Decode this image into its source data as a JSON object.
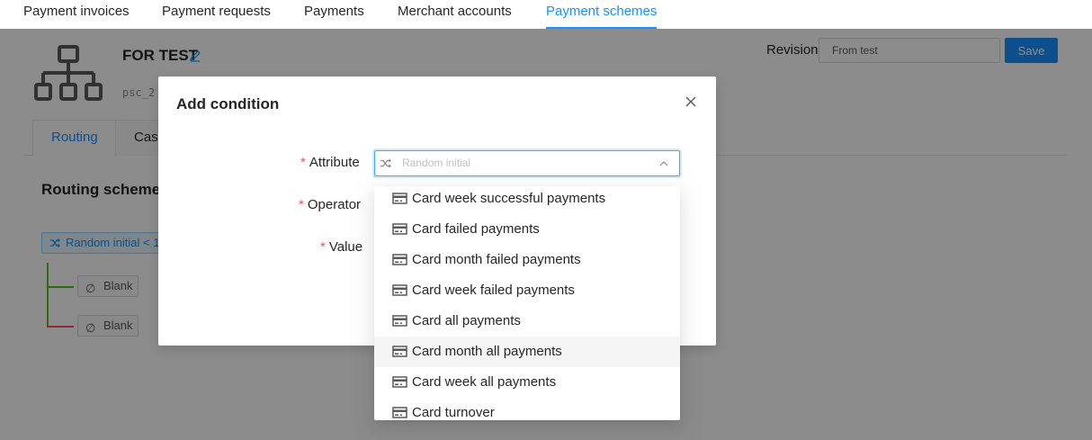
{
  "topnav": {
    "tabs": [
      {
        "label": "Payment invoices"
      },
      {
        "label": "Payment requests"
      },
      {
        "label": "Payments"
      },
      {
        "label": "Merchant accounts"
      },
      {
        "label": "Payment schemes"
      }
    ],
    "active_index": 4
  },
  "scheme": {
    "title": "FOR TEST",
    "code": "psc_2",
    "revision_label": "Revision",
    "revision_value": "From test",
    "save_label": "Save"
  },
  "inner_tabs": [
    {
      "label": "Routing"
    },
    {
      "label": "Casc"
    }
  ],
  "routing": {
    "title": "Routing scheme",
    "condition_label": "Random initial < 1",
    "blank_label": "Blank"
  },
  "modal": {
    "title": "Add condition",
    "attribute_label": "Attribute",
    "operator_label": "Operator",
    "value_label": "Value",
    "attribute_placeholder": "Random initial"
  },
  "dropdown": {
    "items": [
      {
        "label": "Card week successful payments"
      },
      {
        "label": "Card failed payments"
      },
      {
        "label": "Card month failed payments"
      },
      {
        "label": "Card week failed payments"
      },
      {
        "label": "Card all payments"
      },
      {
        "label": "Card month all payments"
      },
      {
        "label": "Card week all payments"
      },
      {
        "label": "Card turnover"
      }
    ],
    "hovered_index": 5
  },
  "colors": {
    "accent": "#1890ff",
    "required": "#ff4d4f"
  }
}
